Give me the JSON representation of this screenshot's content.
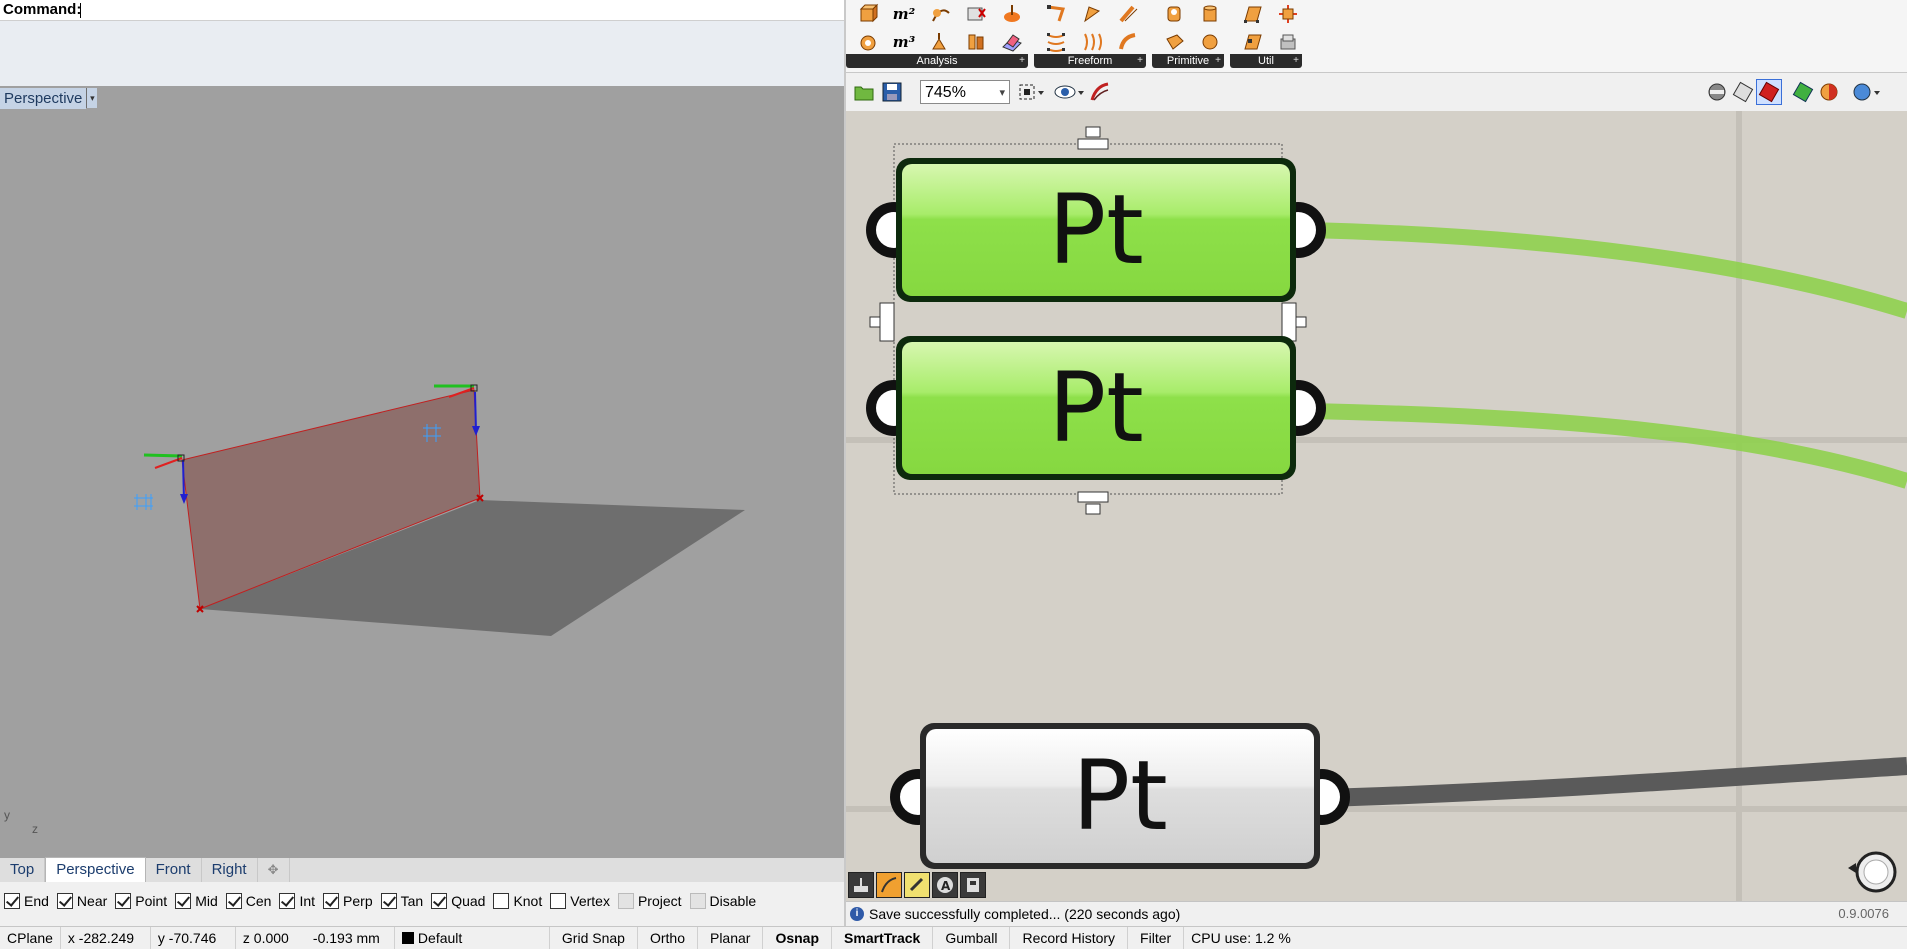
{
  "command": {
    "label": "Command:"
  },
  "viewport": {
    "title": "Perspective",
    "axis_labels": {
      "y": "y",
      "z": "z"
    }
  },
  "viewport_tabs": [
    {
      "label": "Top",
      "active": false
    },
    {
      "label": "Perspective",
      "active": true
    },
    {
      "label": "Front",
      "active": false
    },
    {
      "label": "Right",
      "active": false
    }
  ],
  "osnaps": [
    {
      "label": "End",
      "checked": true
    },
    {
      "label": "Near",
      "checked": true
    },
    {
      "label": "Point",
      "checked": true
    },
    {
      "label": "Mid",
      "checked": true
    },
    {
      "label": "Cen",
      "checked": true
    },
    {
      "label": "Int",
      "checked": true
    },
    {
      "label": "Perp",
      "checked": true
    },
    {
      "label": "Tan",
      "checked": true
    },
    {
      "label": "Quad",
      "checked": true
    },
    {
      "label": "Knot",
      "checked": false
    },
    {
      "label": "Vertex",
      "checked": false
    },
    {
      "label": "Project",
      "checked": false,
      "disabled": true
    },
    {
      "label": "Disable",
      "checked": false,
      "disabled": true
    }
  ],
  "status_bar": {
    "cplane": "CPlane",
    "x": "x -282.249",
    "y": "y -70.746",
    "z": "z 0.000",
    "distance": "-0.193 mm",
    "layer": "Default",
    "layer_color": "#000000",
    "toggles": [
      {
        "label": "Grid Snap",
        "bold": false
      },
      {
        "label": "Ortho",
        "bold": false
      },
      {
        "label": "Planar",
        "bold": false
      },
      {
        "label": "Osnap",
        "bold": true
      },
      {
        "label": "SmartTrack",
        "bold": true
      },
      {
        "label": "Gumball",
        "bold": false
      },
      {
        "label": "Record History",
        "bold": false
      },
      {
        "label": "Filter",
        "bold": false
      }
    ],
    "cpu": "CPU use: 1.2 %"
  },
  "ribbon": {
    "groups": [
      {
        "label": "Analysis",
        "icons": [
          "box-icon",
          "area-icon",
          "measure-icon",
          "bounds-icon",
          "volume-icon",
          "m2-icon",
          "m3-icon",
          "curvature-icon",
          "deviation-icon",
          "moment-icon"
        ],
        "m2": "m²",
        "m3": "m³"
      },
      {
        "label": "Freeform",
        "icons": [
          "loft-icon",
          "sweep-icon",
          "extrude-icon",
          "network-icon",
          "patch-icon",
          "rail-icon"
        ]
      },
      {
        "label": "Primitive",
        "icons": [
          "sphere-icon",
          "cylinder-icon",
          "cone-icon",
          "torus-icon"
        ]
      },
      {
        "label": "Util",
        "icons": [
          "edges-icon",
          "offset-icon",
          "merge-icon",
          "fillet-icon"
        ]
      }
    ]
  },
  "gh_toolbar": {
    "zoom": "745%"
  },
  "components": [
    {
      "label": "Pt",
      "selected": true
    },
    {
      "label": "Pt",
      "selected": true
    },
    {
      "label": "Pt",
      "selected": false
    }
  ],
  "gh_status": {
    "message": "Save successfully completed... (220 seconds ago)",
    "version": "0.9.0076"
  },
  "colors": {
    "component_green": "#8ee04a",
    "wire_green": "#8fd04e",
    "wire_dark": "#5a5a5a",
    "plane_fill": "#8e6f6c",
    "ground": "#6e6e6e"
  }
}
